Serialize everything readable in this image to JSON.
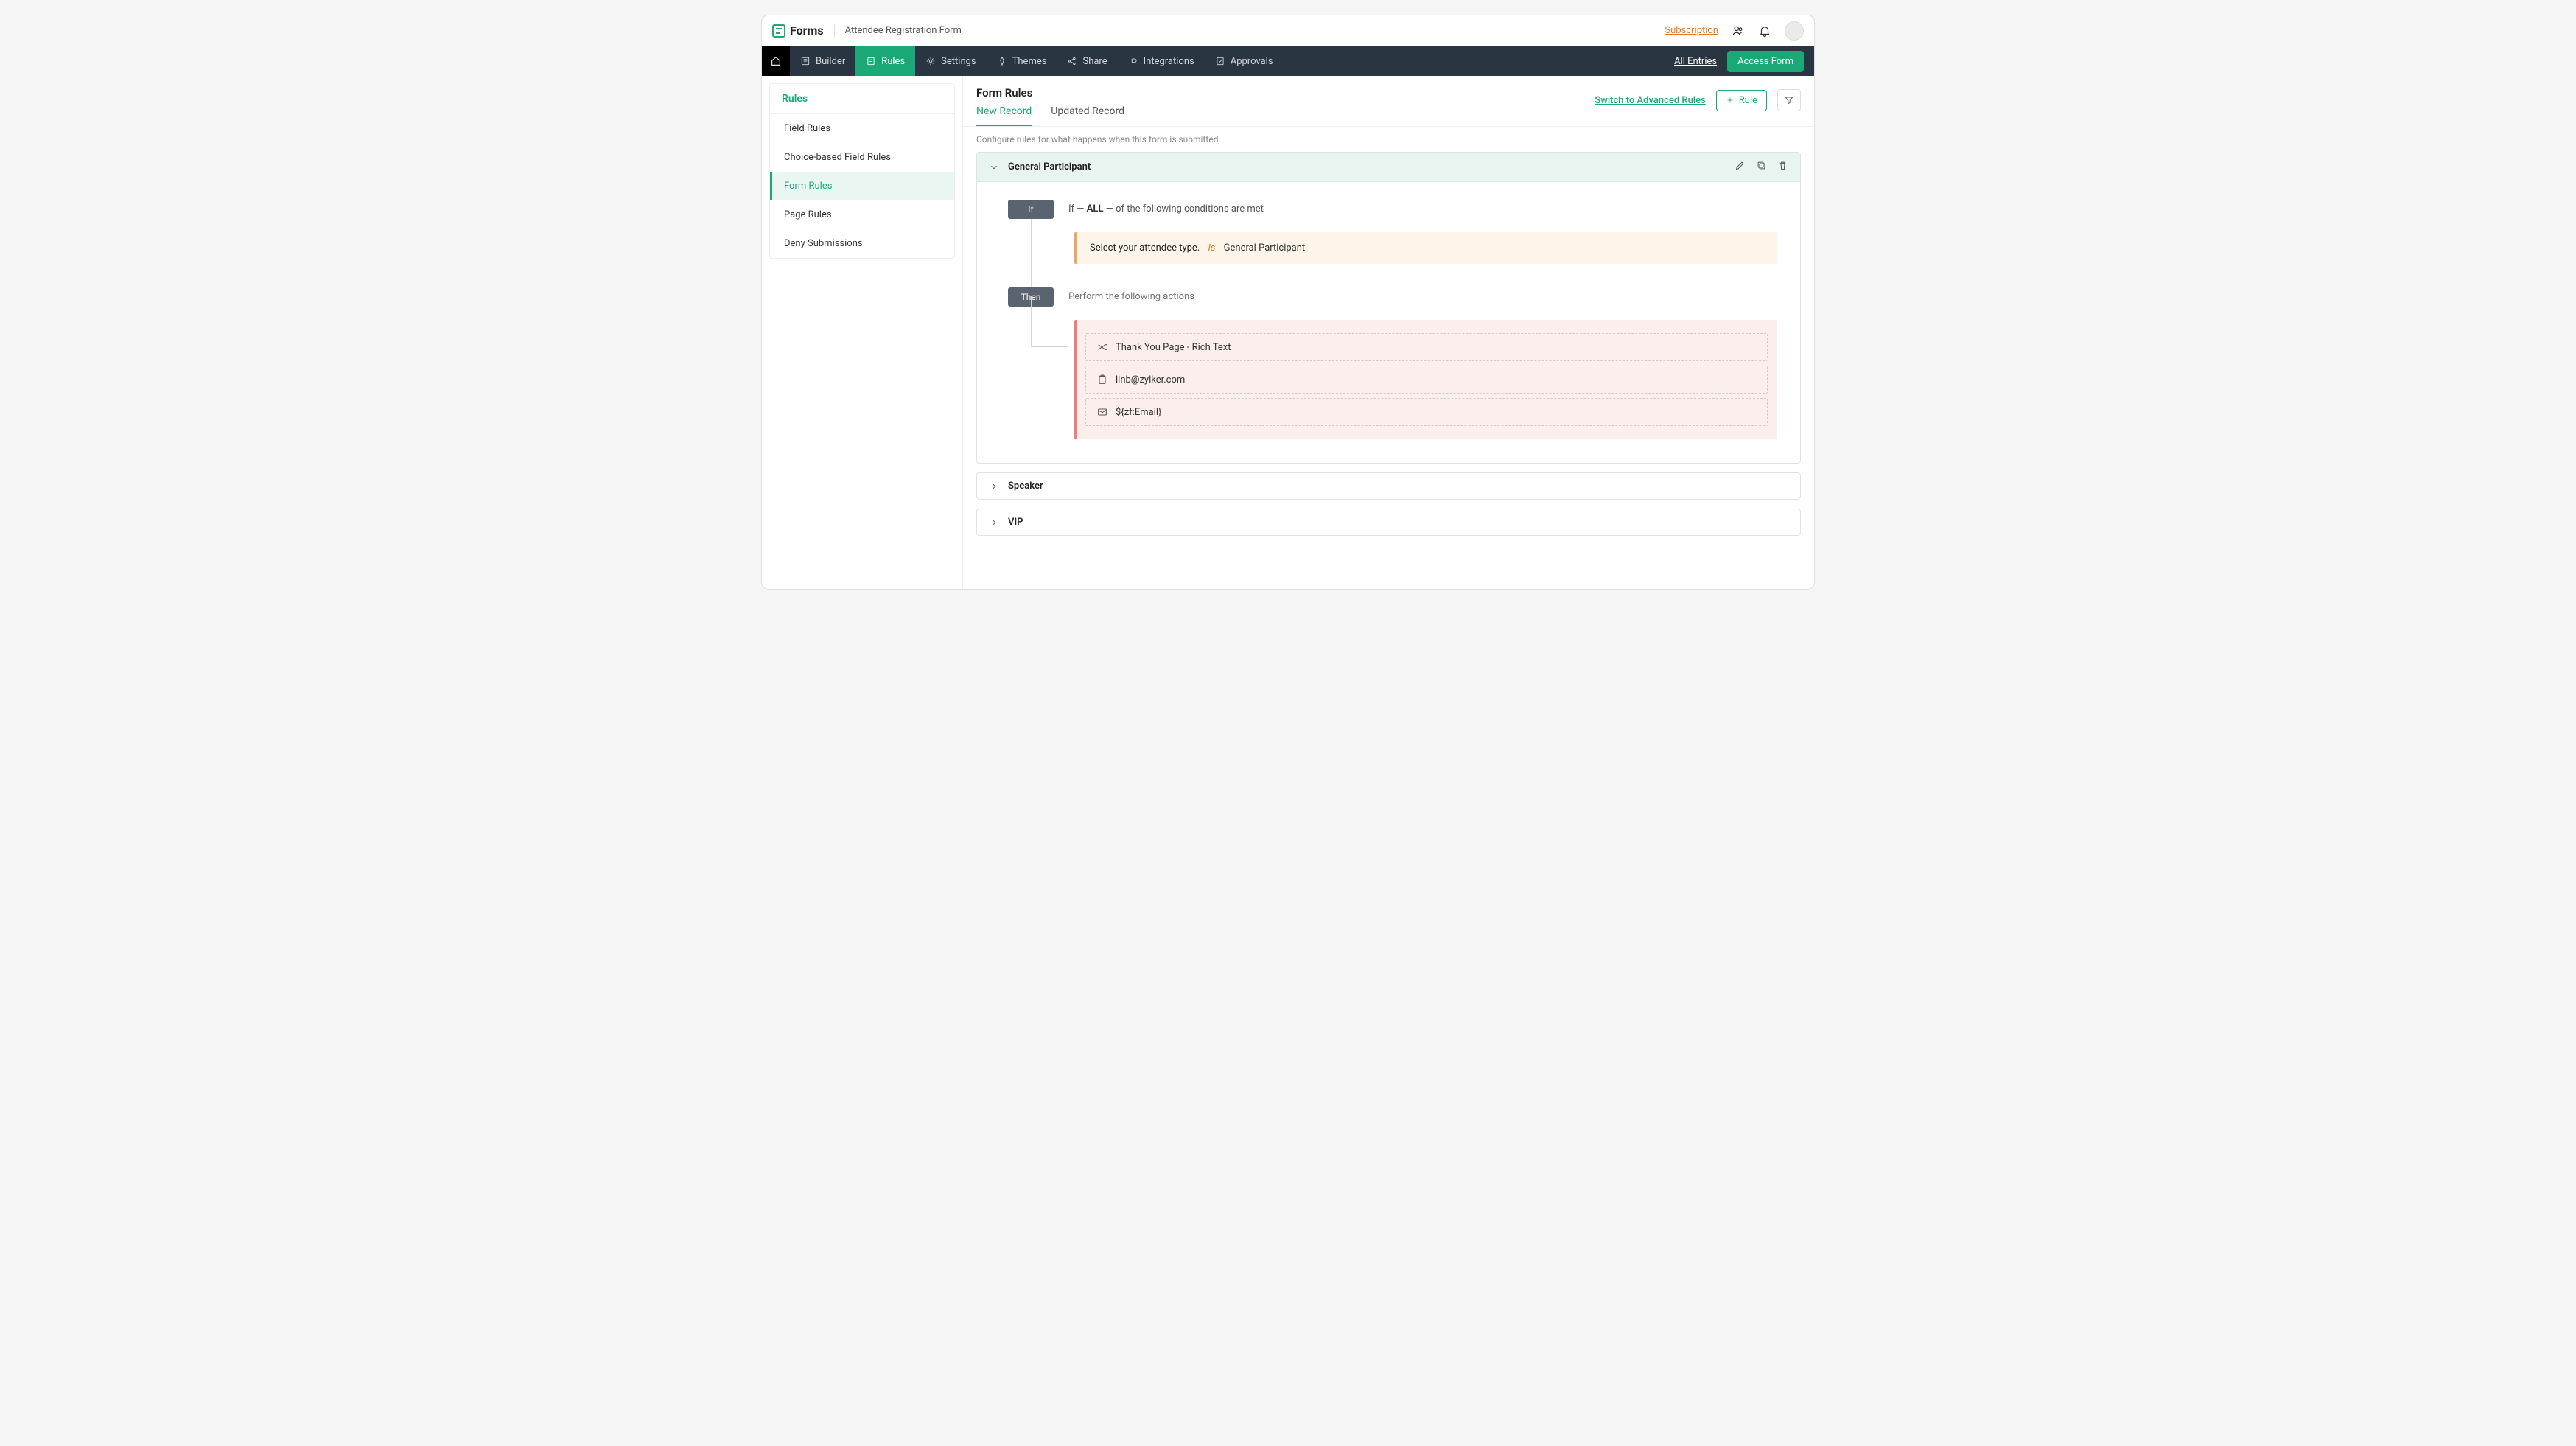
{
  "brand": {
    "name": "Forms",
    "form_name": "Attendee Registration Form"
  },
  "topbar": {
    "subscription": "Subscription"
  },
  "nav": {
    "items": [
      {
        "label": "Builder"
      },
      {
        "label": "Rules"
      },
      {
        "label": "Settings"
      },
      {
        "label": "Themes"
      },
      {
        "label": "Share"
      },
      {
        "label": "Integrations"
      },
      {
        "label": "Approvals"
      }
    ],
    "all_entries": "All Entries",
    "access_form": "Access Form"
  },
  "sidebar": {
    "title": "Rules",
    "items": [
      {
        "label": "Field Rules"
      },
      {
        "label": "Choice-based Field Rules"
      },
      {
        "label": "Form Rules"
      },
      {
        "label": "Page Rules"
      },
      {
        "label": "Deny Submissions"
      }
    ]
  },
  "main": {
    "title": "Form Rules",
    "tabs": [
      {
        "label": "New Record"
      },
      {
        "label": "Updated Record"
      }
    ],
    "advanced_link": "Switch to Advanced Rules",
    "rule_btn": "Rule",
    "subtext": "Configure rules for what happens when this form is submitted."
  },
  "rules": [
    {
      "name": "General Participant",
      "open": true,
      "if_label": "If",
      "if_text_pre": "If — ",
      "if_text_bold": "ALL",
      "if_text_post": " —   of the following conditions are met",
      "condition": {
        "field": "Select your attendee type.",
        "op": "Is",
        "value": "General Participant"
      },
      "then_label": "Then",
      "then_text": "Perform the following actions",
      "actions": [
        {
          "icon": "redirect",
          "text": "Thank You Page - Rich Text"
        },
        {
          "icon": "clipboard",
          "text": "linb@zylker.com"
        },
        {
          "icon": "mail",
          "text": "${zf:Email}"
        }
      ]
    },
    {
      "name": "Speaker",
      "open": false
    },
    {
      "name": "VIP",
      "open": false
    }
  ]
}
